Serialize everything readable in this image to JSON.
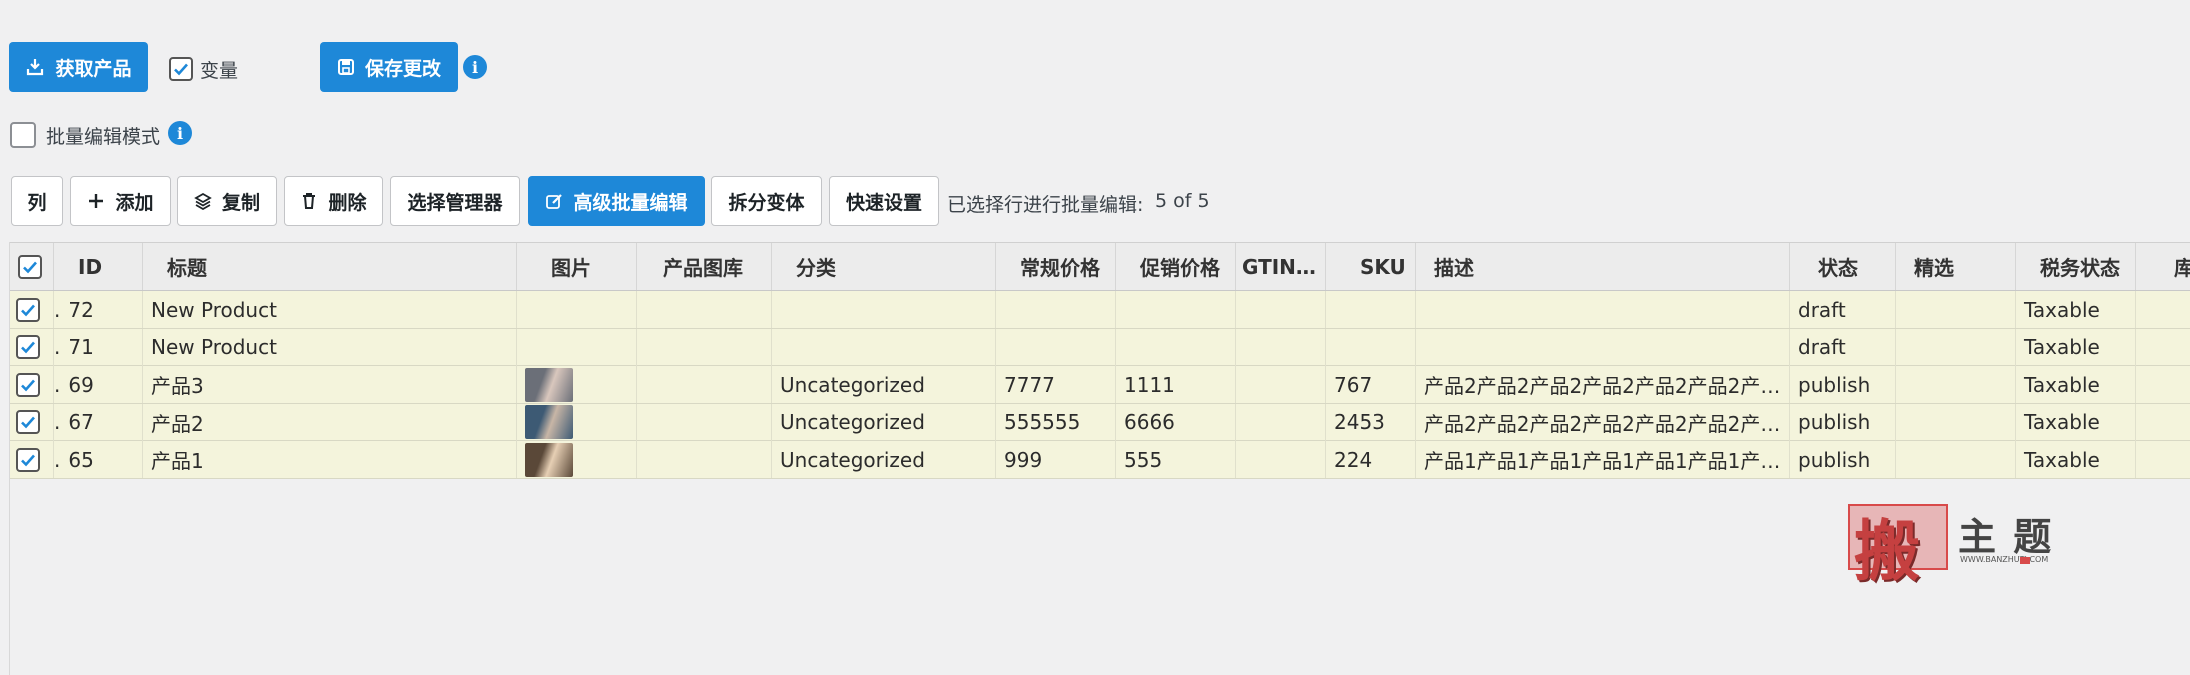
{
  "top": {
    "fetch_label": "获取产品",
    "variant_label": "变量",
    "variant_checked": true,
    "save_label": "保存更改",
    "bulk_mode_label": "批量编辑模式",
    "bulk_mode_checked": false,
    "info_glyph": "i"
  },
  "toolbar": {
    "columns_label": "列",
    "add_label": "添加",
    "copy_label": "复制",
    "delete_label": "删除",
    "selection_manager_label": "选择管理器",
    "advanced_bulk_label": "高级批量编辑",
    "split_variants_label": "拆分变体",
    "quick_settings_label": "快速设置",
    "selection_text": "已选择行进行批量编辑:",
    "selection_count": "5 of 5"
  },
  "table": {
    "columns": [
      "ID",
      "标题",
      "图片",
      "产品图库",
      "分类",
      "常规价格",
      "促销价格",
      "GTIN…",
      "SKU",
      "描述",
      "状态",
      "精选",
      "税务状态",
      "库存"
    ],
    "rows": [
      {
        "id": "72",
        "title": "New Product",
        "has_image": false,
        "category": "",
        "regular_price": "",
        "sale_price": "",
        "gtin": "",
        "sku": "",
        "description": "",
        "status": "draft",
        "featured": "",
        "tax_status": "Taxable"
      },
      {
        "id": "71",
        "title": "New Product",
        "has_image": false,
        "category": "",
        "regular_price": "",
        "sale_price": "",
        "gtin": "",
        "sku": "",
        "description": "",
        "status": "draft",
        "featured": "",
        "tax_status": "Taxable"
      },
      {
        "id": "69",
        "title": "产品3",
        "has_image": true,
        "category": "Uncategorized",
        "regular_price": "7777",
        "sale_price": "1111",
        "gtin": "",
        "sku": "767",
        "description": "产品2产品2产品2产品2产品2产品2产…",
        "status": "publish",
        "featured": "",
        "tax_status": "Taxable"
      },
      {
        "id": "67",
        "title": "产品2",
        "has_image": true,
        "category": "Uncategorized",
        "regular_price": "555555",
        "sale_price": "6666",
        "gtin": "",
        "sku": "2453",
        "description": "产品2产品2产品2产品2产品2产品2产…",
        "status": "publish",
        "featured": "",
        "tax_status": "Taxable"
      },
      {
        "id": "65",
        "title": "产品1",
        "has_image": true,
        "category": "Uncategorized",
        "regular_price": "999",
        "sale_price": "555",
        "gtin": "",
        "sku": "224",
        "description": "产品1产品1产品1产品1产品1产品1产…",
        "status": "publish",
        "featured": "",
        "tax_status": "Taxable"
      }
    ]
  },
  "watermark": {
    "big_char": "搬",
    "text": "主 题",
    "url": "WWW.BANZHUTI.COM"
  },
  "colors": {
    "primary": "#1e88d8",
    "row_bg": "#f4f4dc",
    "watermark_red": "#d84a4a"
  }
}
